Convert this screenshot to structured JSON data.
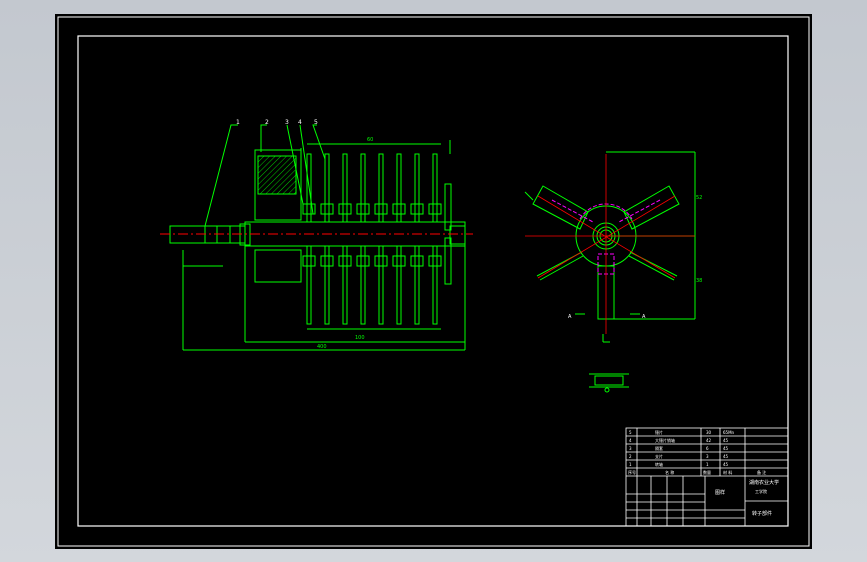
{
  "drawing": {
    "colors": {
      "background": "#000000",
      "frame": "#ffffff",
      "geometry": "#00ff00",
      "centerline": "#ff0000",
      "hidden": "#ff00ff",
      "text": "#ffffff"
    },
    "balloons": [
      "1",
      "2",
      "3",
      "4",
      "5"
    ],
    "dimensions": {
      "top_overall": "60",
      "bottom_overall": "400",
      "bottom_partial": "100",
      "rotor_height": "52",
      "rotor_lower": "38"
    },
    "section_label": "A",
    "title_block": {
      "parts": [
        {
          "no": "5",
          "name": "锤片",
          "qty": "30",
          "material": "65Mn"
        },
        {
          "no": "4",
          "name": "大锤片销轴",
          "qty": "42",
          "material": "45"
        },
        {
          "no": "3",
          "name": "隔套",
          "qty": "6",
          "material": "45"
        },
        {
          "no": "2",
          "name": "支片",
          "qty": "3",
          "material": "45"
        },
        {
          "no": "1",
          "name": "转轴",
          "qty": "1",
          "material": "45"
        }
      ],
      "header": [
        "序号",
        "名 称",
        "数量",
        "材 料",
        "备 注"
      ],
      "school": "湖南农业大学",
      "school_sub": "工学院",
      "drawing_name": "转子部件",
      "assembly": "图样"
    }
  }
}
